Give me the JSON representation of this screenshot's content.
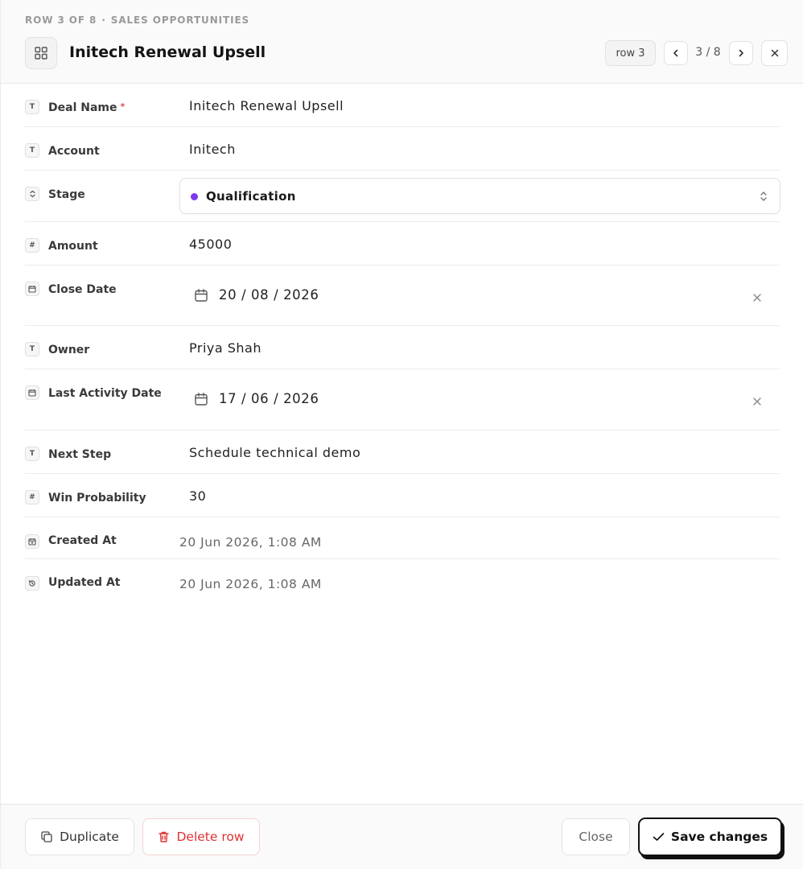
{
  "header": {
    "breadcrumb_row": "ROW 3 OF 8",
    "breadcrumb_sep": "·",
    "breadcrumb_table": "SALES OPPORTUNITIES",
    "title": "Initech Renewal Upsell",
    "row_pill": "row 3",
    "counter": "3 / 8"
  },
  "fields": {
    "deal_name": {
      "icon": "T",
      "label": "Deal Name",
      "required_mark": "*",
      "value": "Initech Renewal Upsell"
    },
    "account": {
      "icon": "T",
      "label": "Account",
      "value": "Initech"
    },
    "stage": {
      "label": "Stage",
      "value": "Qualification",
      "dot_color": "#7c3aed"
    },
    "amount": {
      "icon": "#",
      "label": "Amount",
      "value": "45000"
    },
    "close_date": {
      "label": "Close Date",
      "value": "20 / 08 / 2026"
    },
    "owner": {
      "icon": "T",
      "label": "Owner",
      "value": "Priya Shah"
    },
    "last_activity_date": {
      "label": "Last Activity Date",
      "value": "17 / 06 / 2026"
    },
    "next_step": {
      "icon": "T",
      "label": "Next Step",
      "value": "Schedule technical demo"
    },
    "win_probability": {
      "icon": "#",
      "label": "Win Probability",
      "value": "30"
    },
    "created_at": {
      "label": "Created At",
      "value": "20 Jun 2026, 1:08 AM"
    },
    "updated_at": {
      "label": "Updated At",
      "value": "20 Jun 2026, 1:08 AM"
    }
  },
  "footer": {
    "duplicate_label": "Duplicate",
    "delete_label": "Delete row",
    "close_label": "Close",
    "save_label": "Save changes"
  },
  "colors": {
    "danger": "#e03131",
    "stage_dot": "#7c3aed"
  }
}
